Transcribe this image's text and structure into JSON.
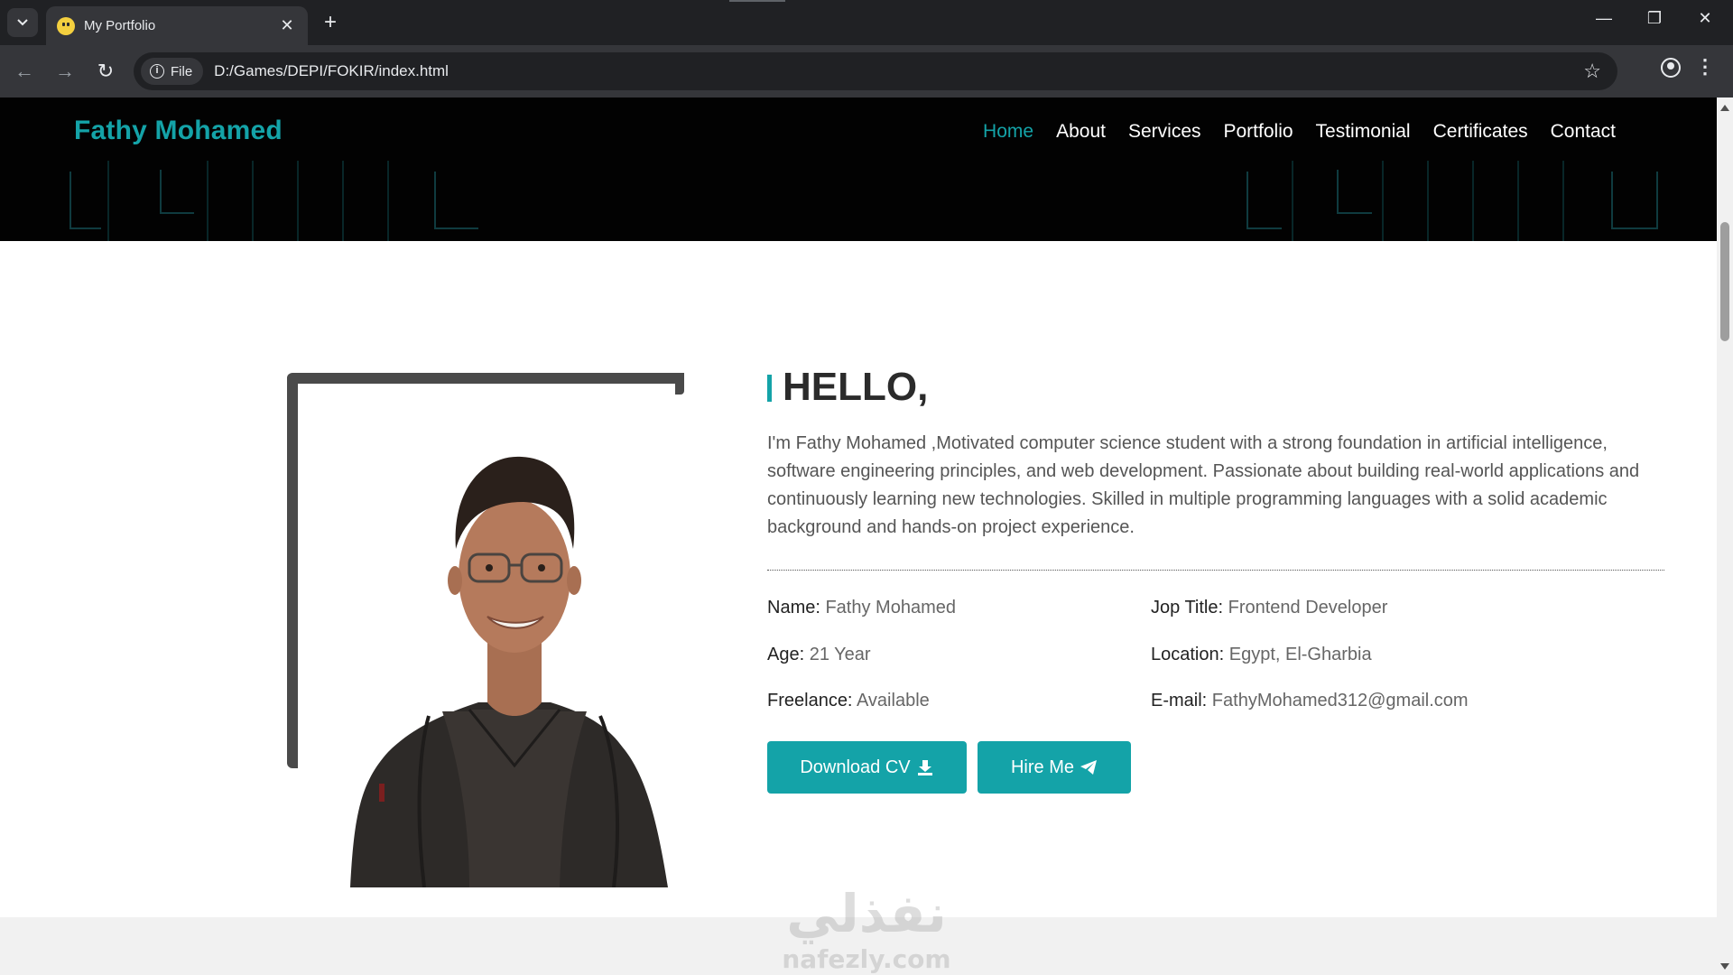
{
  "browser": {
    "tab_title": "My Portfolio",
    "address_chip": "File",
    "url": "D:/Games/DEPI/FOKIR/index.html"
  },
  "site": {
    "brand": "Fathy Mohamed",
    "nav": [
      "Home",
      "About",
      "Services",
      "Portfolio",
      "Testimonial",
      "Certificates",
      "Contact"
    ],
    "active_nav": "Home"
  },
  "about": {
    "heading": "HELLO,",
    "intro": "I'm Fathy Mohamed ,Motivated computer science student with a strong foundation in artificial intelligence, software engineering principles, and web development. Passionate about building real-world applications and continuously learning new technologies. Skilled in multiple programming languages with a solid academic background and hands-on project experience.",
    "details": [
      {
        "label": "Name:",
        "value": "Fathy Mohamed"
      },
      {
        "label": "Jop Title:",
        "value": "Frontend Developer"
      },
      {
        "label": "Age:",
        "value": "21 Year"
      },
      {
        "label": "Location:",
        "value": "Egypt, El-Gharbia"
      },
      {
        "label": "Freelance:",
        "value": "Available"
      },
      {
        "label": "E-mail:",
        "value": "FathyMohamed312@gmail.com"
      }
    ],
    "download_cv": "Download CV",
    "hire_me": "Hire Me"
  },
  "watermark": {
    "arabic": "نفذلي",
    "latin": "nafezly.com"
  },
  "colors": {
    "accent": "#14a3a8",
    "header_bg": "#020202",
    "chrome_dark": "#202124",
    "chrome_mid": "#35363a"
  }
}
